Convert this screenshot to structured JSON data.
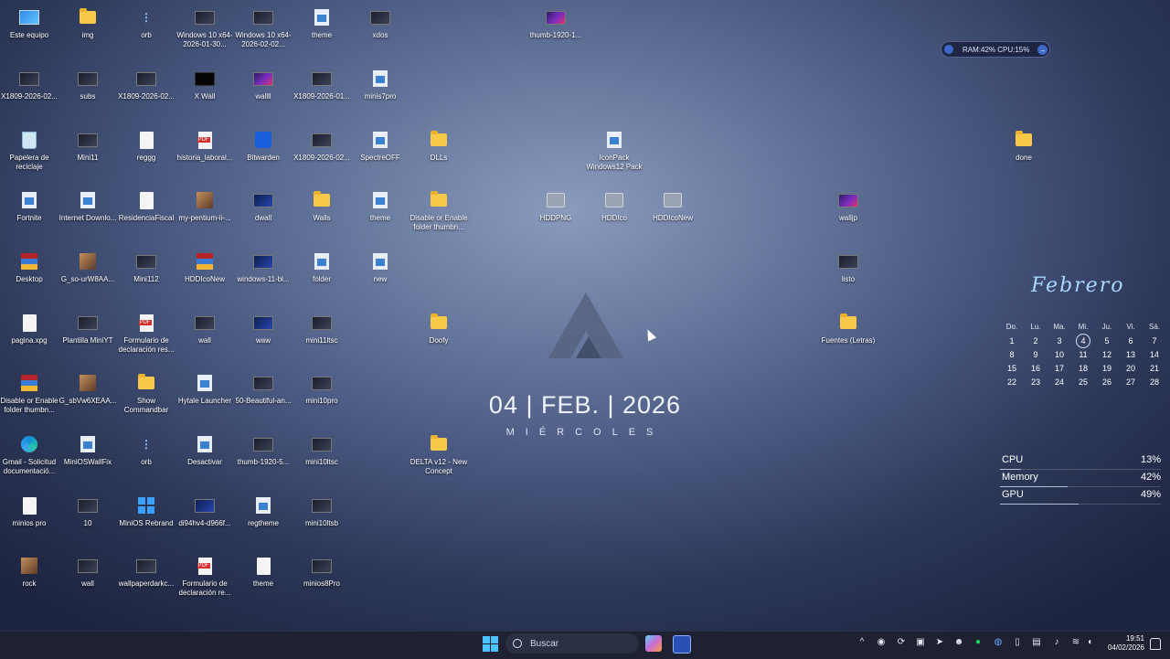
{
  "desktop": {
    "icons": [
      {
        "label": "Este equipo",
        "icon": "monitor-icon"
      },
      {
        "label": "img",
        "icon": "folder-icon"
      },
      {
        "label": "orb",
        "icon": "dots-icon"
      },
      {
        "label": "Windows 10 x64-2026-01-30...",
        "icon": "thumbnail-icon"
      },
      {
        "label": "Windows 10 x64-2026-02-02...",
        "icon": "thumbnail-icon"
      },
      {
        "label": "theme",
        "icon": "app-icon"
      },
      {
        "label": "xdos",
        "icon": "thumbnail-icon"
      },
      {
        "label": "thumb-1920-1...",
        "icon": "thumbnail-icon"
      },
      {
        "label": "X1809-2026-02...",
        "icon": "thumbnail-icon"
      },
      {
        "label": "subs",
        "icon": "thumbnail-icon"
      },
      {
        "label": "X1809-2026-02...",
        "icon": "thumbnail-icon"
      },
      {
        "label": "X Wall",
        "icon": "thumbnail-icon"
      },
      {
        "label": "wallll",
        "icon": "thumbnail-icon"
      },
      {
        "label": "X1809-2026-01...",
        "icon": "thumbnail-icon"
      },
      {
        "label": "minis7pro",
        "icon": "app-icon"
      },
      {
        "label": "Papelera de reciclaje",
        "icon": "recycle-bin-icon"
      },
      {
        "label": "Mini11",
        "icon": "thumbnail-icon"
      },
      {
        "label": "reggg",
        "icon": "document-icon"
      },
      {
        "label": "historia_laboral...",
        "icon": "pdf-icon"
      },
      {
        "label": "Bitwarden",
        "icon": "bitwarden-icon"
      },
      {
        "label": "X1809-2026-02...",
        "icon": "thumbnail-icon"
      },
      {
        "label": "SpectreOFF",
        "icon": "app-icon"
      },
      {
        "label": "DLLs",
        "icon": "folder-icon"
      },
      {
        "label": "IconPack Windows12 Pack",
        "icon": "app-icon"
      },
      {
        "label": "done",
        "icon": "folder-icon"
      },
      {
        "label": "Fortnite",
        "icon": "app-icon"
      },
      {
        "label": "Internet Downlo...",
        "icon": "app-icon"
      },
      {
        "label": "ResidenciaFiscal",
        "icon": "document-icon"
      },
      {
        "label": "my-pentium-ii-...",
        "icon": "photo-icon"
      },
      {
        "label": "dwall",
        "icon": "thumbnail-icon"
      },
      {
        "label": "Walls",
        "icon": "folder-icon"
      },
      {
        "label": "theme",
        "icon": "app-icon"
      },
      {
        "label": "Disable or Enable folder thumbn...",
        "icon": "folder-icon"
      },
      {
        "label": "HDDPNG",
        "icon": "drive-icon"
      },
      {
        "label": "HDDIco",
        "icon": "drive-icon"
      },
      {
        "label": "HDDIcoNew",
        "icon": "drive-icon"
      },
      {
        "label": "walljp",
        "icon": "thumbnail-icon"
      },
      {
        "label": "Desktop",
        "icon": "archive-icon"
      },
      {
        "label": "G_so-urW8AA...",
        "icon": "photo-icon"
      },
      {
        "label": "Mini112",
        "icon": "thumbnail-icon"
      },
      {
        "label": "HDDIcoNew",
        "icon": "archive-icon"
      },
      {
        "label": "windows-11-bl...",
        "icon": "thumbnail-icon"
      },
      {
        "label": "folder",
        "icon": "app-icon"
      },
      {
        "label": "new",
        "icon": "app-icon"
      },
      {
        "label": "listo",
        "icon": "thumbnail-icon"
      },
      {
        "label": "pagina.xpg",
        "icon": "document-icon"
      },
      {
        "label": "Plantilla MiniYT",
        "icon": "thumbnail-icon"
      },
      {
        "label": "Formulario de declaración res...",
        "icon": "pdf-icon"
      },
      {
        "label": "wall",
        "icon": "thumbnail-icon"
      },
      {
        "label": "waw",
        "icon": "thumbnail-icon"
      },
      {
        "label": "mini11ltsc",
        "icon": "thumbnail-icon"
      },
      {
        "label": "Doofy",
        "icon": "folder-icon"
      },
      {
        "label": "Fuentes (Letras)",
        "icon": "folder-icon"
      },
      {
        "label": "Disable or Enable folder thumbn...",
        "icon": "archive-icon"
      },
      {
        "label": "G_sbVw6XEAA...",
        "icon": "photo-icon"
      },
      {
        "label": "Show Commandbar",
        "icon": "folder-icon"
      },
      {
        "label": "Hytale Launcher",
        "icon": "app-icon"
      },
      {
        "label": "50-Beautiful-an...",
        "icon": "thumbnail-icon"
      },
      {
        "label": "mini10pro",
        "icon": "thumbnail-icon"
      },
      {
        "label": "Gmail - Solicitud documentació...",
        "icon": "edge-icon"
      },
      {
        "label": "MiniOSWallFix",
        "icon": "app-icon"
      },
      {
        "label": "orb",
        "icon": "dots-icon"
      },
      {
        "label": "Desactivar",
        "icon": "app-icon"
      },
      {
        "label": "thumb-1920-5...",
        "icon": "thumbnail-icon"
      },
      {
        "label": "mini10ltsc",
        "icon": "thumbnail-icon"
      },
      {
        "label": "DELTA v12 - New Concept",
        "icon": "folder-icon"
      },
      {
        "label": "minios pro",
        "icon": "document-icon"
      },
      {
        "label": "10",
        "icon": "thumbnail-icon"
      },
      {
        "label": "MiniOS Rebrand",
        "icon": "windows-logo-icon"
      },
      {
        "label": "di94hv4-d966f...",
        "icon": "thumbnail-icon"
      },
      {
        "label": "regtheme",
        "icon": "app-icon"
      },
      {
        "label": "mini10ltsb",
        "icon": "thumbnail-icon"
      },
      {
        "label": "rock",
        "icon": "photo-icon"
      },
      {
        "label": "wall",
        "icon": "thumbnail-icon"
      },
      {
        "label": "wallpaperdarkc...",
        "icon": "thumbnail-icon"
      },
      {
        "label": "Formulario de declaración re...",
        "icon": "pdf-icon"
      },
      {
        "label": "theme",
        "icon": "document-icon"
      },
      {
        "label": "minios8Pro",
        "icon": "thumbnail-icon"
      }
    ]
  },
  "system_monitor": {
    "text": "RAM:42%  CPU:15%"
  },
  "clock_widget": {
    "date": "04 | FEB. | 2026",
    "weekday": "MIÉRCOLES"
  },
  "calendar": {
    "month": "Febrero",
    "weekdays": [
      "Do.",
      "Lu.",
      "Ma.",
      "Mi.",
      "Ju.",
      "Vi.",
      "Sá."
    ],
    "weeks": [
      [
        "1",
        "2",
        "3",
        "4",
        "5",
        "6",
        "7"
      ],
      [
        "8",
        "9",
        "10",
        "11",
        "12",
        "13",
        "14"
      ],
      [
        "15",
        "16",
        "17",
        "18",
        "19",
        "20",
        "21"
      ],
      [
        "22",
        "23",
        "24",
        "25",
        "26",
        "27",
        "28"
      ]
    ],
    "today": "4"
  },
  "meters": [
    {
      "label": "CPU",
      "value": "13%",
      "fraction": 0.13
    },
    {
      "label": "Memory",
      "value": "42%",
      "fraction": 0.42
    },
    {
      "label": "GPU",
      "value": "49%",
      "fraction": 0.49
    }
  ],
  "taskbar": {
    "search_placeholder": "Buscar",
    "time": "19:51",
    "date": "04/02/2026"
  }
}
